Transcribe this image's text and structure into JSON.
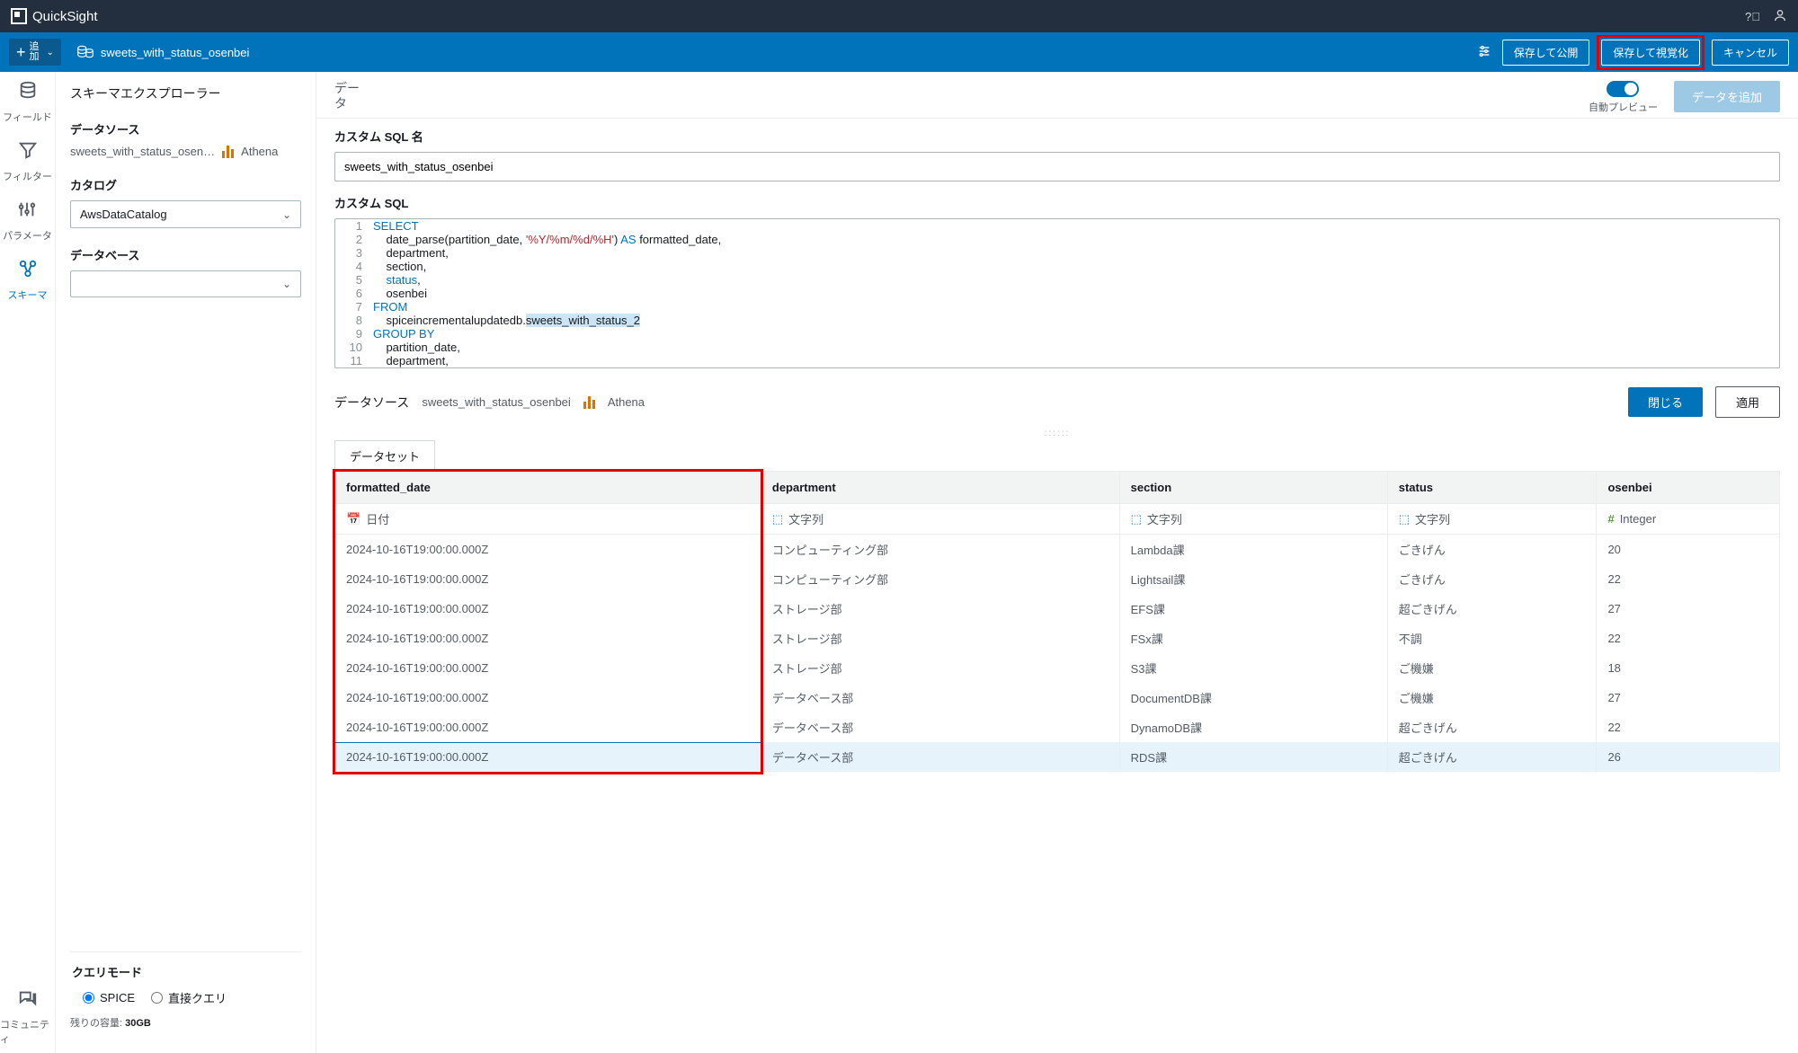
{
  "app": {
    "name": "QuickSight"
  },
  "secondbar": {
    "add": "追\n加",
    "dataset_name": "sweets_with_status_osenbei",
    "save_publish": "保存して公開",
    "save_visualize": "保存して視覚化",
    "cancel": "キャンセル"
  },
  "rail": {
    "fields": "フィールド",
    "filter": "フィルター",
    "params": "パラメータ",
    "schema": "スキーマ",
    "community": "コミュニティ"
  },
  "schema": {
    "explorer_title": "スキーマエクスプローラー",
    "datasource_label": "データソース",
    "datasource_name": "sweets_with_status_osen…",
    "datasource_engine": "Athena",
    "catalog_label": "カタログ",
    "catalog_value": "AwsDataCatalog",
    "database_label": "データベース",
    "database_value": ""
  },
  "query_mode": {
    "title": "クエリモード",
    "spice": "SPICE",
    "direct": "直接クエリ",
    "capacity_label": "残りの容量:",
    "capacity_value": "30GB"
  },
  "data_header": {
    "title": "デー\nタ",
    "auto_preview": "自動プレビュー",
    "add_data": "データを追加"
  },
  "sql": {
    "name_label": "カスタム SQL 名",
    "name_value": "sweets_with_status_osenbei",
    "code_label": "カスタム SQL",
    "lines": [
      {
        "n": "1",
        "pre": "",
        "kw": "SELECT",
        "post": ""
      },
      {
        "n": "2",
        "pre": "    date_parse(partition_date, ",
        "str": "'%Y/%m/%d/%H'",
        "mid": ") ",
        "kw": "AS",
        "post": " formatted_date,"
      },
      {
        "n": "3",
        "pre": "    department,"
      },
      {
        "n": "4",
        "pre": "    section,"
      },
      {
        "n": "5",
        "pre": "    ",
        "kw": "status",
        "post": ","
      },
      {
        "n": "6",
        "pre": "    osenbei"
      },
      {
        "n": "7",
        "pre": "",
        "kw": "FROM"
      },
      {
        "n": "8",
        "pre": "    spiceincrementalupdatedb.",
        "hl": "sweets_with_status_2"
      },
      {
        "n": "9",
        "pre": "",
        "kw": "GROUP BY"
      },
      {
        "n": "10",
        "pre": "    partition_date,"
      },
      {
        "n": "11",
        "pre": "    department,"
      }
    ]
  },
  "ds_footer": {
    "label": "データソース",
    "name": "sweets_with_status_osenbei",
    "engine": "Athena",
    "close": "閉じる",
    "apply": "適用"
  },
  "table": {
    "tab": "データセット",
    "columns": [
      {
        "name": "formatted_date",
        "type": "日付",
        "icon": "date"
      },
      {
        "name": "department",
        "type": "文字列",
        "icon": "string"
      },
      {
        "name": "section",
        "type": "文字列",
        "icon": "string"
      },
      {
        "name": "status",
        "type": "文字列",
        "icon": "string"
      },
      {
        "name": "osenbei",
        "type": "Integer",
        "icon": "int"
      }
    ],
    "rows": [
      [
        "2024-10-16T19:00:00.000Z",
        "コンピューティング部",
        "Lambda課",
        "ごきげん",
        "20"
      ],
      [
        "2024-10-16T19:00:00.000Z",
        "コンピューティング部",
        "Lightsail課",
        "ごきげん",
        "22"
      ],
      [
        "2024-10-16T19:00:00.000Z",
        "ストレージ部",
        "EFS課",
        "超ごきげん",
        "27"
      ],
      [
        "2024-10-16T19:00:00.000Z",
        "ストレージ部",
        "FSx課",
        "不調",
        "22"
      ],
      [
        "2024-10-16T19:00:00.000Z",
        "ストレージ部",
        "S3課",
        "ご機嫌",
        "18"
      ],
      [
        "2024-10-16T19:00:00.000Z",
        "データベース部",
        "DocumentDB課",
        "ご機嫌",
        "27"
      ],
      [
        "2024-10-16T19:00:00.000Z",
        "データベース部",
        "DynamoDB課",
        "超ごきげん",
        "22"
      ],
      [
        "2024-10-16T19:00:00.000Z",
        "データベース部",
        "RDS課",
        "超ごきげん",
        "26"
      ]
    ]
  }
}
